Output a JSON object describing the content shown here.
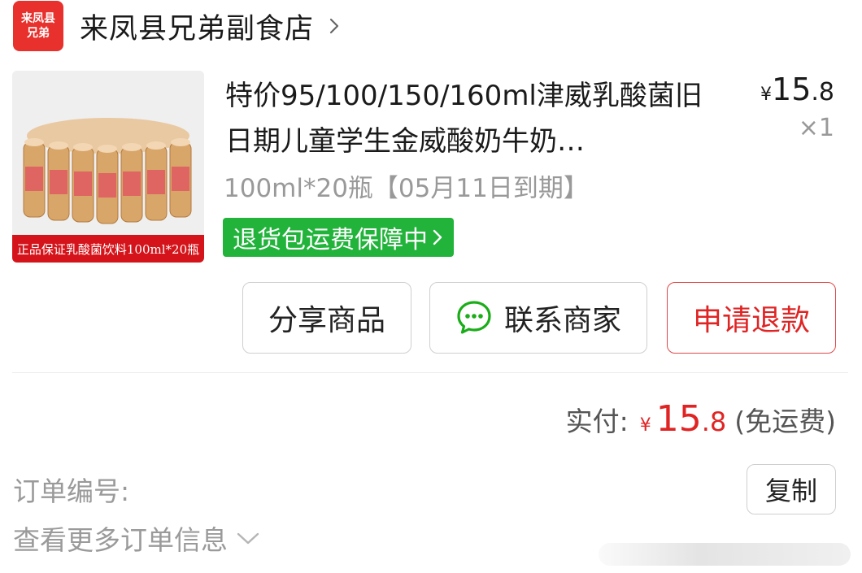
{
  "shop": {
    "logo_line1": "来凤县",
    "logo_line2": "兄弟",
    "name": "来凤县兄弟副食店",
    "chevron_icon": "chevron-right-icon"
  },
  "product": {
    "image_caption": "正品保证乳酸菌饮料100ml*20瓶",
    "title": "特价95/100/150/160ml津威乳酸菌旧日期儿童学生金威酸奶牛奶…",
    "price_symbol": "¥",
    "price_int": "15",
    "price_dec": ".8",
    "quantity": "×1",
    "spec": "100ml*20瓶【05月11日到期】",
    "refund_badge": "退货包运费保障中"
  },
  "actions": {
    "share": "分享商品",
    "contact": "联系商家",
    "refund": "申请退款"
  },
  "payment": {
    "label": "实付:",
    "symbol": "¥",
    "int": "15",
    "dec": ".8",
    "note": "(免运费)"
  },
  "order": {
    "number_label": "订单编号:",
    "copy": "复制",
    "more": "查看更多订单信息"
  },
  "colors": {
    "brand_red": "#e8302c",
    "price_red": "#e02424",
    "badge_green": "#21b33a",
    "wechat_green": "#1aad19"
  }
}
